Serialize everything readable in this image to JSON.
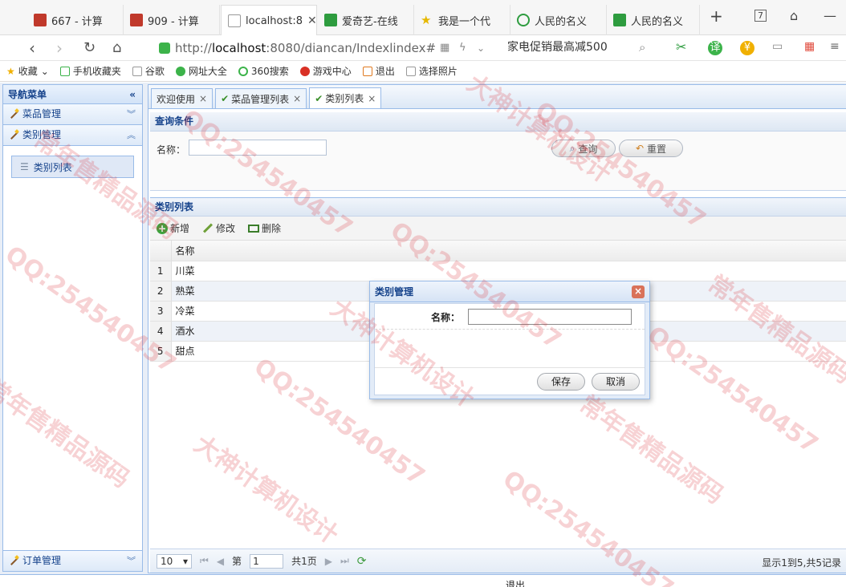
{
  "browser": {
    "tabs": [
      {
        "title": "667 - 计算",
        "icon_color": "#c0392b"
      },
      {
        "title": "909 - 计算",
        "icon_color": "#c0392b"
      },
      {
        "title": "localhost:8",
        "icon_color": "#999999"
      },
      {
        "title": "爱奇艺-在线",
        "icon_color": "#2e9c3f"
      },
      {
        "title": "我是一个代",
        "icon_color": "#e6b800"
      },
      {
        "title": "人民的名义",
        "icon_color": "#2e9c3f"
      },
      {
        "title": "人民的名义",
        "icon_color": "#2e9c3f"
      }
    ],
    "tab_count": "7",
    "url_prefix": "http://",
    "url_host": "localhost",
    "url_rest": ":8080/diancan/Indexlindex#",
    "promo": "家电促销最高减500",
    "bookmarks": [
      "收藏",
      "手机收藏夹",
      "谷歌",
      "网址大全",
      "360搜索",
      "游戏中心",
      "退出",
      "选择照片"
    ]
  },
  "sidebar": {
    "title": "导航菜单",
    "sections": [
      "菜品管理",
      "类别管理",
      "订单管理"
    ],
    "active_item": "类别列表"
  },
  "content_tabs": [
    "欢迎使用",
    "菜品管理列表",
    "类别列表"
  ],
  "query": {
    "title": "查询条件",
    "name_label": "名称：",
    "search_button": "查询",
    "reset_button": "重置"
  },
  "grid": {
    "title": "类别列表",
    "add_button": "新增",
    "edit_button": "修改",
    "delete_button": "删除",
    "column_name": "名称",
    "rows": [
      {
        "no": "1",
        "name": "川菜"
      },
      {
        "no": "2",
        "name": "熟菜"
      },
      {
        "no": "3",
        "name": "冷菜"
      },
      {
        "no": "4",
        "name": "酒水"
      },
      {
        "no": "5",
        "name": "甜点"
      }
    ]
  },
  "pager": {
    "page_size": "10",
    "page_prefix": "第",
    "page_value": "1",
    "page_total": "共1页",
    "info": "显示1到5,共5记录"
  },
  "dialog": {
    "title": "类别管理",
    "name_label": "名称：",
    "save_button": "保存",
    "cancel_button": "取消"
  },
  "footer": {
    "left": "(部分可见)",
    "right": "退出"
  },
  "watermarks": [
    "QQ:254540457",
    "大神计算机设计",
    "常年售精品源码"
  ]
}
